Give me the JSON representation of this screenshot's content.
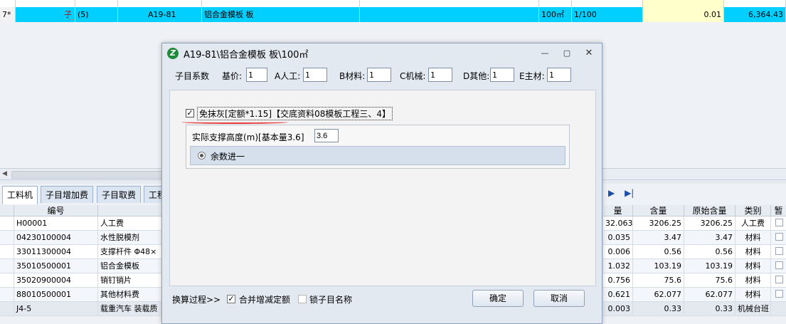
{
  "top_grid": {
    "prev_row": {
      "num": "",
      "code": "",
      "name": "",
      "unit": "",
      "ratio": "",
      "qty": "",
      "total": ""
    },
    "selected_row": {
      "num": "7*",
      "type": "子",
      "seq": "(5)",
      "code": "A19-81",
      "name": "铝合金模板 板",
      "unit": "100㎡",
      "ratio": "1/100",
      "qty": "0.01",
      "total": "6,364.43"
    }
  },
  "bottom": {
    "tabs": [
      "工料机",
      "子目增加费",
      "子目取费",
      "工程"
    ],
    "headers": {
      "code": "编号",
      "qty_left": "量",
      "qty": "含量",
      "orig_qty": "原始含量",
      "category": "类别",
      "last": "暂"
    },
    "rows": [
      {
        "code": "H00001",
        "name": "人工费",
        "v1": "32.063",
        "qty": "3206.25",
        "orig": "3206.25",
        "cat": "人工费"
      },
      {
        "code": "04230100004",
        "name": "水性脱模剂",
        "v1": "0.035",
        "qty": "3.47",
        "orig": "3.47",
        "cat": "材料"
      },
      {
        "code": "33011300004",
        "name": "支撑杆件 Φ48×",
        "v1": "0.006",
        "qty": "0.56",
        "orig": "0.56",
        "cat": "材料"
      },
      {
        "code": "35010500001",
        "name": "铝合金模板",
        "v1": "1.032",
        "qty": "103.19",
        "orig": "103.19",
        "cat": "材料"
      },
      {
        "code": "35020900004",
        "name": "销钉销片",
        "v1": "0.756",
        "qty": "75.6",
        "orig": "75.6",
        "cat": "材料"
      },
      {
        "code": "88010500001",
        "name": "其他材料费",
        "v1": "0.621",
        "qty": "62.077",
        "orig": "62.077",
        "cat": "材料"
      },
      {
        "code": "J4-5",
        "name": "载重汽车 装载质",
        "v1": "0.003",
        "qty": "0.33",
        "orig": "0.33",
        "cat": "机械台班"
      }
    ]
  },
  "dialog": {
    "title": "A19-81\\铝合金模板 板\\100㎡",
    "coef": {
      "label": "子目系数",
      "fields": [
        {
          "label": "基价:",
          "value": "1"
        },
        {
          "label": "A人工:",
          "value": "1"
        },
        {
          "label": "B材料:",
          "value": "1"
        },
        {
          "label": "C机械:",
          "value": "1"
        },
        {
          "label": "D其他:",
          "value": "1"
        },
        {
          "label": "E主材:",
          "value": "1"
        }
      ]
    },
    "option": {
      "checked": true,
      "label": "免抹灰[定额*1.15]【交底资料08模板工程三、4】"
    },
    "support": {
      "label": "实际支撑高度(m)[基本量3.6]",
      "value": "3.6",
      "radio_label": "余数进一"
    },
    "footer": {
      "process_label": "换算过程>>",
      "merge_label": "合并增减定额",
      "merge_checked": true,
      "lock_label": "锁子目名称",
      "lock_checked": false,
      "ok": "确定",
      "cancel": "取消"
    }
  }
}
